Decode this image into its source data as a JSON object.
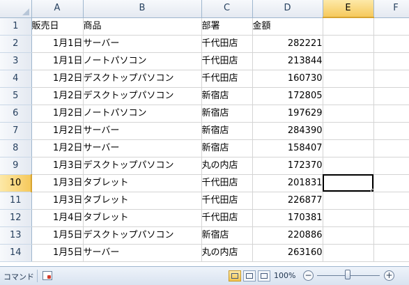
{
  "sheet": {
    "columns": [
      "A",
      "B",
      "C",
      "D",
      "E",
      "F"
    ],
    "active_column": "E",
    "active_row": 10,
    "rows": [
      {
        "row": 1,
        "cells": [
          "販売日",
          "商品",
          "部署",
          "金額"
        ]
      },
      {
        "row": 2,
        "cells": [
          "1月1日",
          "サーバー",
          "千代田店",
          "282221"
        ]
      },
      {
        "row": 3,
        "cells": [
          "1月1日",
          "ノートパソコン",
          "千代田店",
          "213844"
        ]
      },
      {
        "row": 4,
        "cells": [
          "1月2日",
          "デスクトップパソコン",
          "千代田店",
          "160730"
        ]
      },
      {
        "row": 5,
        "cells": [
          "1月2日",
          "デスクトップパソコン",
          "新宿店",
          "172805"
        ]
      },
      {
        "row": 6,
        "cells": [
          "1月2日",
          "ノートパソコン",
          "新宿店",
          "197629"
        ]
      },
      {
        "row": 7,
        "cells": [
          "1月2日",
          "サーバー",
          "新宿店",
          "284390"
        ]
      },
      {
        "row": 8,
        "cells": [
          "1月2日",
          "サーバー",
          "新宿店",
          "158407"
        ]
      },
      {
        "row": 9,
        "cells": [
          "1月3日",
          "デスクトップパソコン",
          "丸の内店",
          "172370"
        ]
      },
      {
        "row": 10,
        "cells": [
          "1月3日",
          "タブレット",
          "千代田店",
          "201831"
        ]
      },
      {
        "row": 11,
        "cells": [
          "1月3日",
          "タブレット",
          "千代田店",
          "226877"
        ]
      },
      {
        "row": 12,
        "cells": [
          "1月4日",
          "タブレット",
          "千代田店",
          "170381"
        ]
      },
      {
        "row": 13,
        "cells": [
          "1月5日",
          "デスクトップパソコン",
          "新宿店",
          "220886"
        ]
      },
      {
        "row": 14,
        "cells": [
          "1月5日",
          "サーバー",
          "丸の内店",
          "263160"
        ]
      }
    ]
  },
  "status_bar": {
    "mode": "コマンド",
    "zoom": "100%",
    "zoom_out": "−",
    "zoom_in": "+",
    "macro_icon": "macro-record-icon",
    "view_icons": [
      "normal-view-icon",
      "page-layout-view-icon",
      "page-break-view-icon"
    ]
  },
  "colors": {
    "header_bg": "#e4e9f1",
    "active_header": "#f6c95c",
    "gridline": "#d4d4d4"
  }
}
